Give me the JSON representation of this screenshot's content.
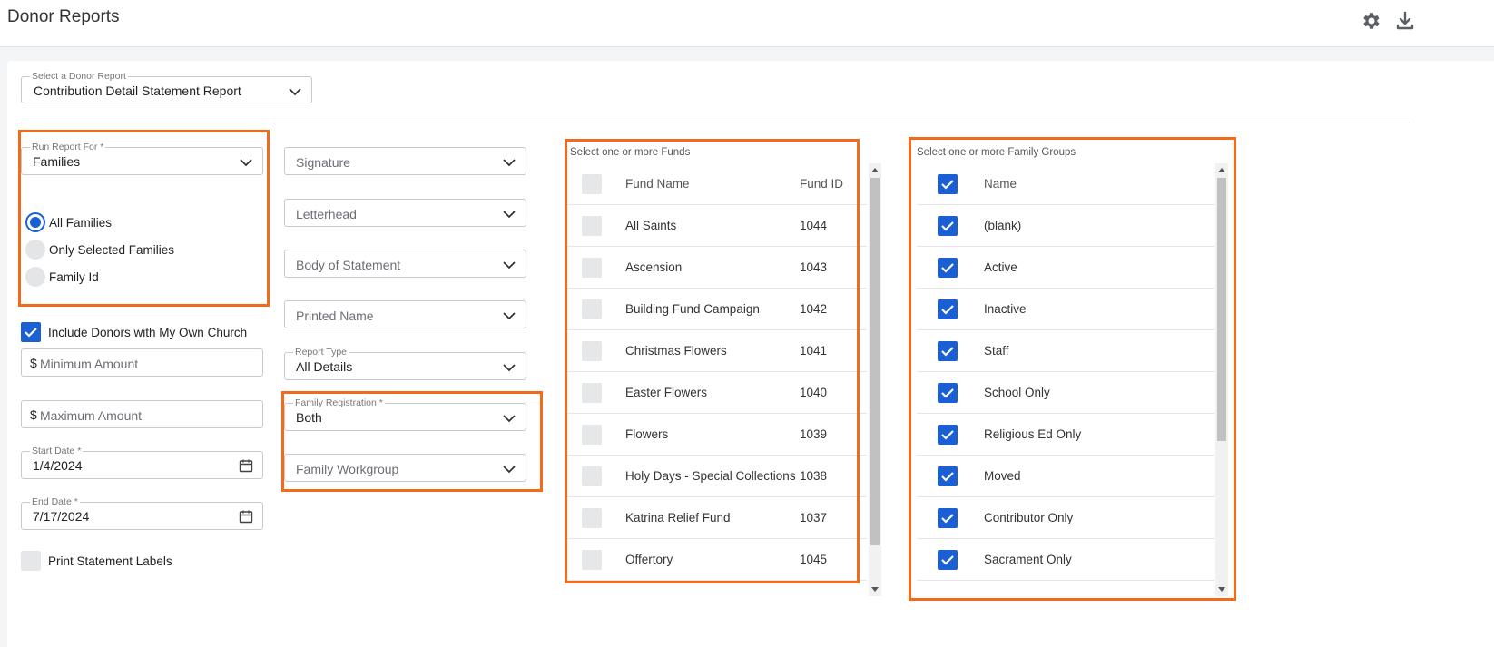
{
  "header": {
    "title": "Donor Reports",
    "icons": [
      "gear-icon",
      "download-icon"
    ]
  },
  "report_select": {
    "label": "Select a Donor Report",
    "value": "Contribution Detail Statement Report"
  },
  "run_report_for": {
    "label": "Run Report For *",
    "value": "Families",
    "options": [
      {
        "label": "All Families",
        "selected": true
      },
      {
        "label": "Only Selected Families",
        "selected": false
      },
      {
        "label": "Family Id",
        "selected": false
      }
    ]
  },
  "include_own_church": {
    "label": "Include Donors with My Own Church",
    "checked": true
  },
  "currency_symbol": "$",
  "minimum_amount": {
    "placeholder": "Minimum Amount"
  },
  "maximum_amount": {
    "placeholder": "Maximum Amount"
  },
  "start_date": {
    "label": "Start Date *",
    "value": "1/4/2024"
  },
  "end_date": {
    "label": "End Date *",
    "value": "7/17/2024"
  },
  "print_labels": {
    "label": "Print Statement Labels",
    "checked": false
  },
  "signature": {
    "placeholder": "Signature"
  },
  "letterhead": {
    "placeholder": "Letterhead"
  },
  "body_of_statement": {
    "placeholder": "Body of Statement"
  },
  "printed_name": {
    "placeholder": "Printed Name"
  },
  "report_type": {
    "label": "Report Type",
    "value": "All Details"
  },
  "family_registration": {
    "label": "Family Registration *",
    "value": "Both"
  },
  "family_workgroup": {
    "placeholder": "Family Workgroup"
  },
  "funds": {
    "title": "Select one or more Funds",
    "headers": {
      "name": "Fund Name",
      "id": "Fund ID"
    },
    "rows": [
      {
        "name": "All Saints",
        "id": "1044"
      },
      {
        "name": "Ascension",
        "id": "1043"
      },
      {
        "name": "Building Fund Campaign",
        "id": "1042"
      },
      {
        "name": "Christmas Flowers",
        "id": "1041"
      },
      {
        "name": "Easter Flowers",
        "id": "1040"
      },
      {
        "name": "Flowers",
        "id": "1039"
      },
      {
        "name": "Holy Days - Special Collections",
        "id": "1038"
      },
      {
        "name": "Katrina Relief Fund",
        "id": "1037"
      },
      {
        "name": "Offertory",
        "id": "1045"
      }
    ]
  },
  "family_groups": {
    "title": "Select one or more Family Groups",
    "header": "Name",
    "rows": [
      "(blank)",
      "Active",
      "Inactive",
      "Staff",
      "School Only",
      "Religious Ed Only",
      "Moved",
      "Contributor Only",
      "Sacrament Only"
    ]
  },
  "colors": {
    "accent": "#1a5fd3",
    "highlight": "#f26b1d"
  }
}
